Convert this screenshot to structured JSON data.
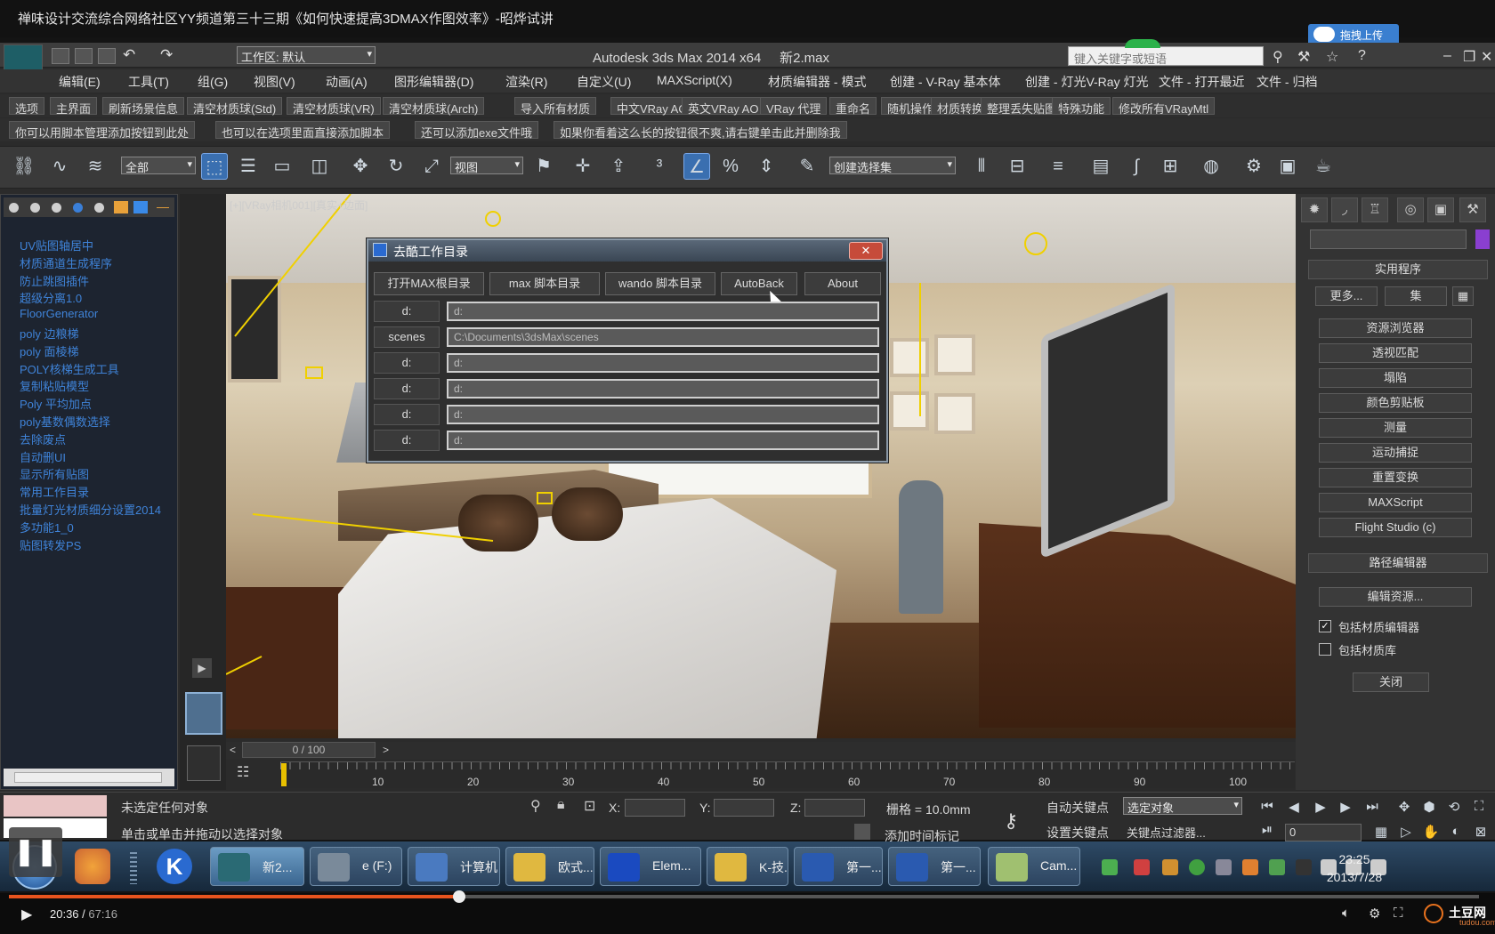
{
  "video_title": "禅味设计交流综合网络社区YY频道第三十三期《如何快速提高3DMAX作图效率》-昭烨试讲",
  "upload_button": "拖拽上传",
  "app": {
    "title": "Autodesk 3ds Max  2014 x64",
    "file": "新2.max",
    "workspace": "工作区: 默认",
    "search_placeholder": "键入关键字或短语"
  },
  "menu": [
    "编辑(E)",
    "工具(T)",
    "组(G)",
    "视图(V)",
    "动画(A)",
    "图形编辑器(D)",
    "渲染(R)",
    "自定义(U)",
    "MAXScript(X)",
    "材质编辑器 - 模式",
    "创建 - V-Ray 基本体",
    "创建 - 灯光V-Ray 灯光",
    "文件 - 打开最近",
    "文件 - 归档"
  ],
  "button_row1": [
    "选项",
    "主界面",
    "刷新场景信息",
    "清空材质球(Std)",
    "清空材质球(VR)",
    "清空材质球(Arch)",
    "导入所有材质",
    "中文VRay AO",
    "英文VRay AO",
    "VRay 代理",
    "重命名",
    "随机操作",
    "材质转换",
    "整理丢失贴图",
    "特殊功能",
    "修改所有VRayMtl"
  ],
  "button_row2": [
    "你可以用脚本管理添加按钮到此处",
    "也可以在选项里面直接添加脚本",
    "还可以添加exe文件哦",
    "如果你看着这么长的按钮很不爽,请右键单击此并删除我"
  ],
  "toolbar": {
    "filter": "全部",
    "refcoord": "视图",
    "selset": "创建选择集"
  },
  "script_list": [
    "UV贴图轴居中",
    "材质通道生成程序",
    "防止跳图插件",
    "超级分离1.0",
    "FloorGenerator",
    "poly 边粮梯",
    "poly 面棱梯",
    "POLY核梯生成工具",
    "复制粘贴模型",
    "Poly 平均加点",
    "poly基数偶数选择",
    "去除废点",
    "自动删UI",
    "显示所有贴图",
    "常用工作目录",
    "批量灯光材质细分设置2014",
    "多功能1_0",
    "贴图转发PS"
  ],
  "viewport_label": "[+][VRay相机001][真实+边面]",
  "dialog": {
    "title": "去酷工作目录",
    "close": "✕",
    "buttons": [
      "打开MAX根目录",
      "max 脚本目录",
      "wando 脚本目录",
      "AutoBack",
      "About"
    ],
    "rows": [
      {
        "label": "d:",
        "value": "d:"
      },
      {
        "label": "scenes",
        "value": "C:\\Documents\\3dsMax\\scenes"
      },
      {
        "label": "d:",
        "value": "d:"
      },
      {
        "label": "d:",
        "value": "d:"
      },
      {
        "label": "d:",
        "value": "d:"
      },
      {
        "label": "d:",
        "value": "d:"
      }
    ]
  },
  "right_panel": {
    "section1": "实用程序",
    "more": "更多...",
    "sets": "集",
    "buttons": [
      "资源浏览器",
      "透视匹配",
      "塌陷",
      "颜色剪贴板",
      "测量",
      "运动捕捉",
      "重置变换",
      "MAXScript",
      "Flight Studio (c)"
    ],
    "section2": "路径编辑器",
    "edit_resources": "编辑资源...",
    "check1": "包括材质编辑器",
    "check1_checked": true,
    "check2": "包括材质库",
    "check2_checked": false,
    "close": "关闭"
  },
  "timeline": {
    "slider": "0 / 100",
    "ticks": [
      "10",
      "20",
      "30",
      "40",
      "50",
      "60",
      "70",
      "80",
      "90",
      "100"
    ]
  },
  "status": {
    "line1": "未选定任何对象",
    "line2": "单击或单击并拖动以选择对象",
    "x_label": "X:",
    "y_label": "Y:",
    "z_label": "Z:",
    "grid": "栅格 = 10.0mm",
    "auto_key": "自动关键点",
    "set_key": "设置关键点",
    "selected": "选定对象",
    "key_filter": "关键点过滤器...",
    "add_tag": "添加时间标记",
    "frame": "0"
  },
  "taskbar": {
    "tasks": [
      "新2...",
      "e (F:)",
      "计算机",
      "欧式...",
      "Elem...",
      "K-技...",
      "第一...",
      "第一...",
      "Cam..."
    ],
    "time": "23:25",
    "date": "2013/7/28"
  },
  "player": {
    "current": "20:36",
    "total": "67:16",
    "brand": "土豆网",
    "brand_url": "tudou.com",
    "progress": 0.306
  }
}
